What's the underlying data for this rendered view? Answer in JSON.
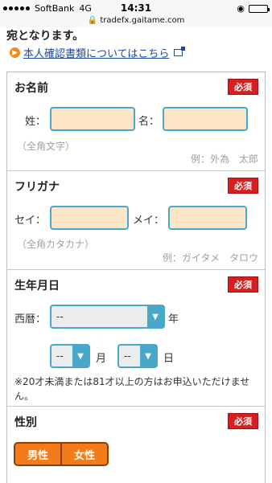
{
  "status": {
    "carrier": "SoftBank",
    "network": "4G",
    "time": "14:31"
  },
  "browser": {
    "url": "tradefx.gaitame.com"
  },
  "intro": {
    "text": "宛となります。",
    "link": "本人確認書類についてはこちら"
  },
  "required_label": "必須",
  "name": {
    "title": "お名前",
    "sei_label": "姓：",
    "mei_label": "名：",
    "hint": "（全角文字）",
    "example": "例：外為　太郎"
  },
  "kana": {
    "title": "フリガナ",
    "sei_label": "セイ：",
    "mei_label": "メイ：",
    "hint": "（全角カタカナ）",
    "example": "例：ガイタメ　タロウ"
  },
  "birth": {
    "title": "生年月日",
    "era_label": "西暦：",
    "year_value": "--",
    "year_unit": "年",
    "month_value": "--",
    "month_unit": "月",
    "day_value": "--",
    "day_unit": "日",
    "note": "※20才未満または81才以上の方はお申込いただけません。"
  },
  "gender": {
    "title": "性別",
    "male": "男性",
    "female": "女性"
  }
}
